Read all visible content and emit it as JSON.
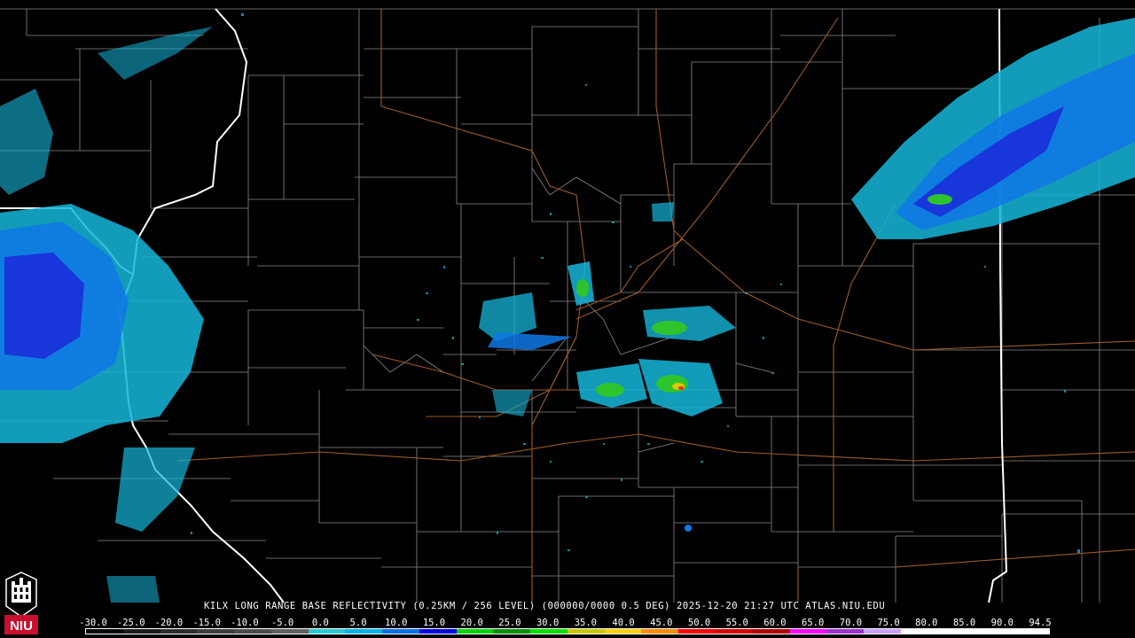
{
  "product": {
    "caption": "KILX LONG RANGE BASE REFLECTIVITY (0.25KM / 256 LEVEL) (000000/0000 0.5 DEG) 2025-12-20 21:27 UTC  ATLAS.NIU.EDU"
  },
  "legend": {
    "tick_labels": [
      "-30.0",
      "-25.0",
      "-20.0",
      "-15.0",
      "-10.0",
      "-5.0",
      "0.0",
      "5.0",
      "10.0",
      "15.0",
      "20.0",
      "25.0",
      "30.0",
      "35.0",
      "40.0",
      "45.0",
      "50.0",
      "55.0",
      "60.0",
      "65.0",
      "70.0",
      "75.0",
      "80.0",
      "85.0",
      "90.0",
      "94.5"
    ],
    "colors": [
      "#000000",
      "#1a1a1a",
      "#2d2d2d",
      "#3c3c3c",
      "#4a4a4a",
      "#606060",
      "#2ac8d2",
      "#00b4e6",
      "#0070e8",
      "#0000e0",
      "#00d200",
      "#009000",
      "#00e000",
      "#c8c800",
      "#ffd000",
      "#ff8c00",
      "#ff0000",
      "#d40000",
      "#b00000",
      "#ff00ff",
      "#9a32cc",
      "#c8a0ff",
      "#ffffff",
      "#ffffff",
      "#ffffff",
      "#ffffff"
    ]
  },
  "logo": {
    "text": "NIU",
    "color": "#c8102e"
  },
  "map": {
    "background": "#000000",
    "county_line_color": "#8a8a8a",
    "state_line_color": "#ffffff",
    "road_color": "#9c5a2a"
  }
}
